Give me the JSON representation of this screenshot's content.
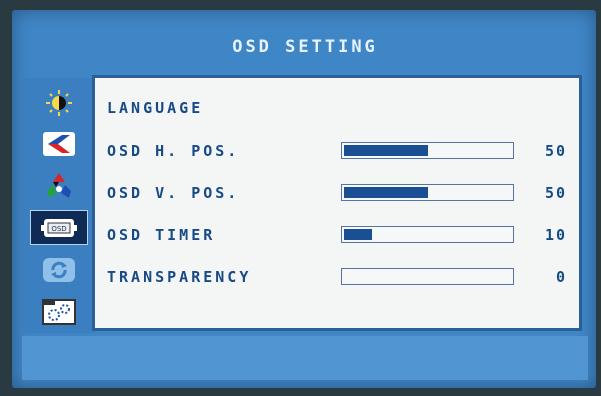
{
  "osd": {
    "title": "OSD SETTING",
    "rows": [
      {
        "label": "LANGUAGE"
      },
      {
        "label": "OSD H. POS.",
        "value": "50",
        "level": 0.5
      },
      {
        "label": "OSD V. POS.",
        "value": "50",
        "level": 0.5
      },
      {
        "label": "OSD TIMER",
        "value": "10",
        "level": 0.17
      },
      {
        "label": "TRANSPARENCY",
        "value": "0",
        "level": 0
      }
    ]
  },
  "sidebar": {
    "items": [
      {
        "icon": "brightness-contrast-icon"
      },
      {
        "icon": "image-position-icon"
      },
      {
        "icon": "color-icon"
      },
      {
        "icon": "osd-icon",
        "active": true
      },
      {
        "icon": "reset-icon"
      },
      {
        "icon": "misc-settings-icon"
      }
    ]
  },
  "colors": {
    "accent": "#1a4f93",
    "panel": "#f4f6f5",
    "frame": "#3f86c7"
  }
}
